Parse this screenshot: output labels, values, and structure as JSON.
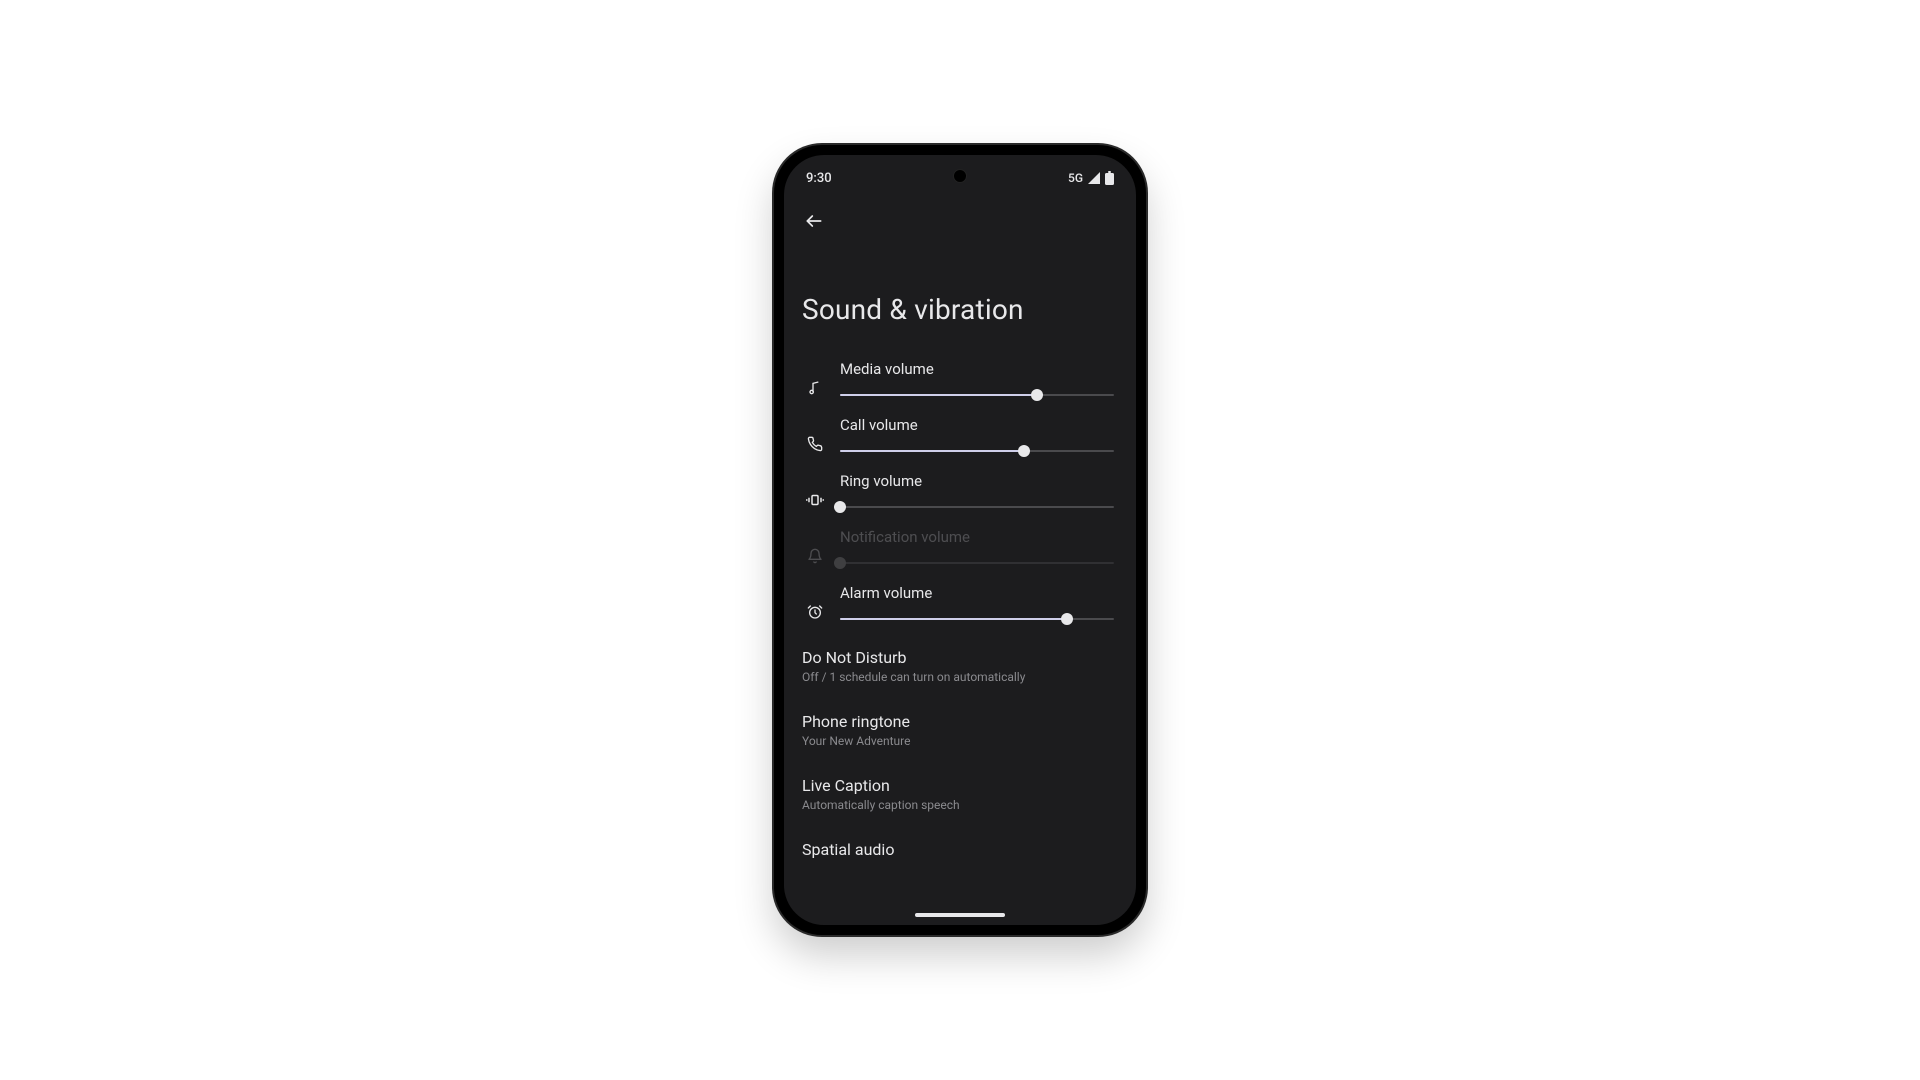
{
  "status": {
    "time": "9:30",
    "network": "5G"
  },
  "appbar": {},
  "page": {
    "title": "Sound & vibration"
  },
  "sliders": {
    "media": {
      "label": "Media volume",
      "value": 72,
      "disabled": false
    },
    "call": {
      "label": "Call volume",
      "value": 67,
      "disabled": false
    },
    "ring": {
      "label": "Ring volume",
      "value": 0,
      "disabled": false
    },
    "notification": {
      "label": "Notification volume",
      "value": 0,
      "disabled": true
    },
    "alarm": {
      "label": "Alarm volume",
      "value": 83,
      "disabled": false
    }
  },
  "items": {
    "dnd": {
      "title": "Do Not Disturb",
      "sub": "Off / 1 schedule can turn on automatically"
    },
    "ringtone": {
      "title": "Phone ringtone",
      "sub": "Your New Adventure"
    },
    "caption": {
      "title": "Live Caption",
      "sub": "Automatically caption speech"
    },
    "spatial": {
      "title": "Spatial audio",
      "sub": ""
    }
  }
}
